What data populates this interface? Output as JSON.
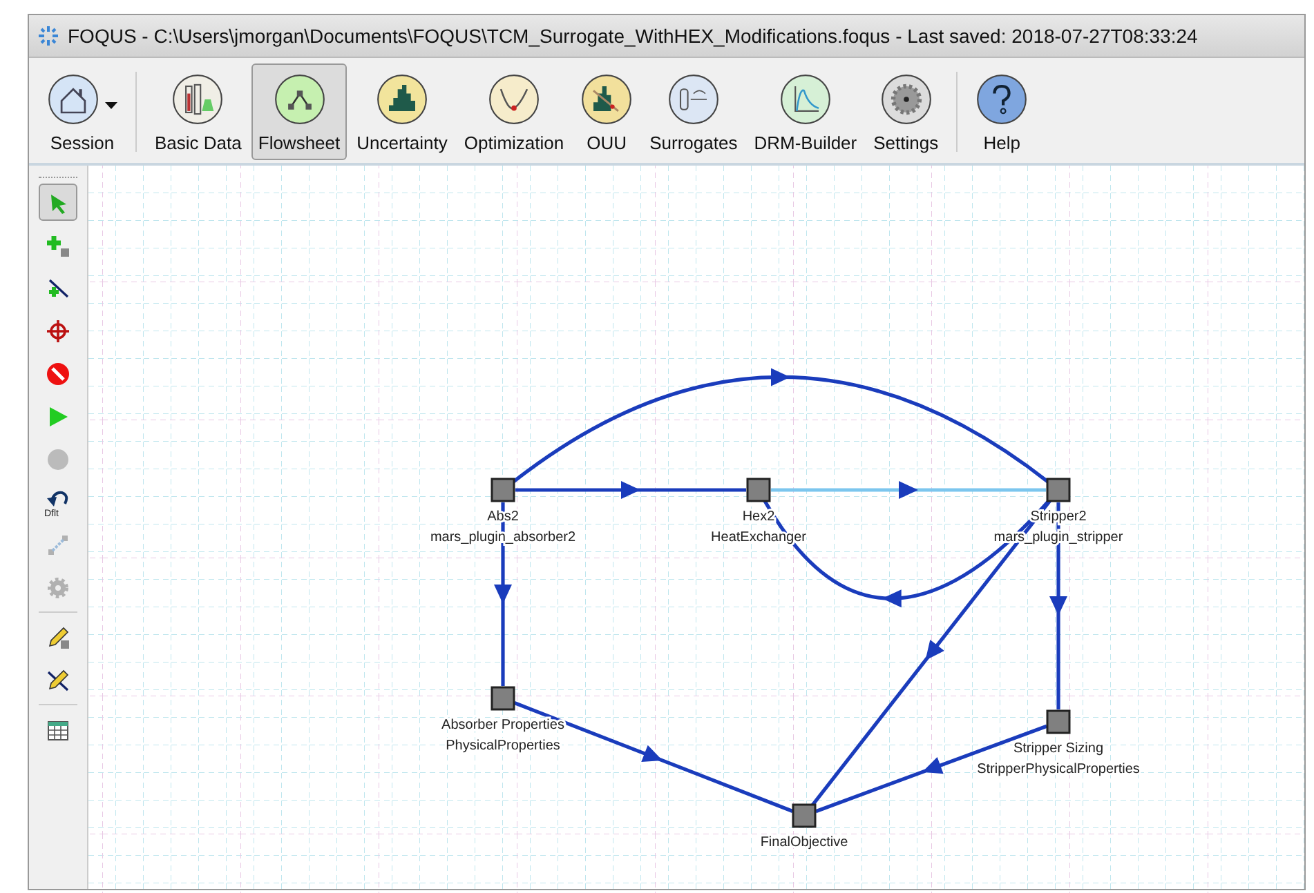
{
  "window": {
    "title": "FOQUS - C:\\Users\\jmorgan\\Documents\\FOQUS\\TCM_Surrogate_WithHEX_Modifications.foqus - Last saved: 2018-07-27T08:33:24"
  },
  "toolbar": {
    "groups": [
      {
        "items": [
          {
            "label": "Session",
            "selected": false,
            "dropdown": true
          }
        ]
      },
      {
        "items": [
          {
            "label": "Basic Data",
            "selected": false,
            "dropdown": false
          },
          {
            "label": "Flowsheet",
            "selected": true,
            "dropdown": false
          },
          {
            "label": "Uncertainty",
            "selected": false,
            "dropdown": false
          },
          {
            "label": "Optimization",
            "selected": false,
            "dropdown": false
          },
          {
            "label": "OUU",
            "selected": false,
            "dropdown": false
          },
          {
            "label": "Surrogates",
            "selected": false,
            "dropdown": false
          },
          {
            "label": "DRM-Builder",
            "selected": false,
            "dropdown": false
          },
          {
            "label": "Settings",
            "selected": false,
            "dropdown": false
          }
        ]
      },
      {
        "items": [
          {
            "label": "Help",
            "selected": false,
            "dropdown": false
          }
        ]
      }
    ]
  },
  "tools": {
    "groups": [
      {
        "items": [
          {
            "selected": true,
            "disabled": false
          },
          {
            "selected": false,
            "disabled": false
          },
          {
            "selected": false,
            "disabled": false
          },
          {
            "selected": false,
            "disabled": false
          },
          {
            "selected": false,
            "disabled": false
          },
          {
            "selected": false,
            "disabled": false
          },
          {
            "selected": false,
            "disabled": true
          },
          {
            "selected": false,
            "disabled": false,
            "caption": "Dflt"
          },
          {
            "selected": false,
            "disabled": true
          },
          {
            "selected": false,
            "disabled": true
          }
        ]
      },
      {
        "items": [
          {
            "selected": false,
            "disabled": false
          },
          {
            "selected": false,
            "disabled": false
          }
        ]
      },
      {
        "items": [
          {
            "selected": false,
            "disabled": false
          }
        ]
      }
    ]
  },
  "flowsheet": {
    "nodes": [
      {
        "name": "Abs2",
        "model": "mars_plugin_absorber2"
      },
      {
        "name": "Hex2",
        "model": "HeatExchanger"
      },
      {
        "name": "Stripper2",
        "model": "mars_plugin_stripper"
      },
      {
        "name": "Absorber Properties",
        "model": "PhysicalProperties"
      },
      {
        "name": "Stripper Sizing",
        "model": "StripperPhysicalProperties"
      },
      {
        "name": "FinalObjective"
      }
    ],
    "edges": [
      {
        "kind": "straight",
        "selected": false
      },
      {
        "kind": "straight",
        "selected": true
      },
      {
        "kind": "arc_up",
        "selected": false
      },
      {
        "kind": "arc_down",
        "selected": false
      },
      {
        "kind": "straight",
        "selected": false
      },
      {
        "kind": "straight",
        "selected": false
      },
      {
        "kind": "straight",
        "selected": false
      },
      {
        "kind": "straight",
        "selected": false
      },
      {
        "kind": "straight",
        "selected": false
      }
    ]
  }
}
